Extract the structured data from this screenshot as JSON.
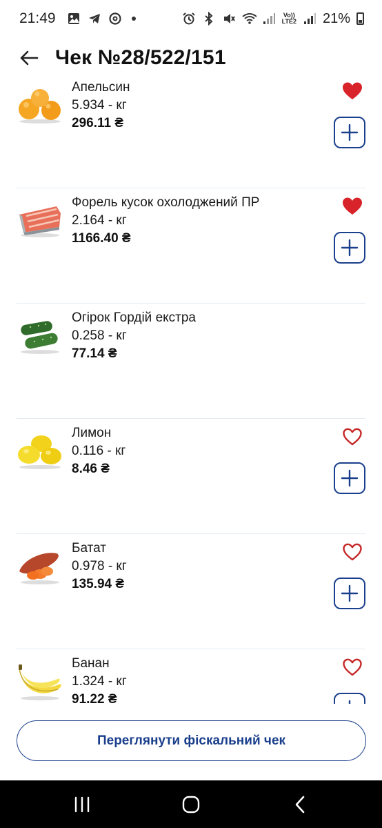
{
  "status_bar": {
    "time": "21:49",
    "network": "LTE2",
    "network_top": "Vo))",
    "battery": "21%",
    "left_icons": [
      "gallery-icon",
      "telegram-icon",
      "threads-icon",
      "dot-icon"
    ],
    "right_icons": [
      "alarm-icon",
      "bluetooth-icon",
      "mute-icon",
      "wifi-icon",
      "signal-icon",
      "signal-icon",
      "battery-icon"
    ]
  },
  "header": {
    "title": "Чек №28/522/151",
    "back_icon": "arrow-left-icon"
  },
  "currency": "₴",
  "items": [
    {
      "name": "Апельсин",
      "qty": "5.934 - кг",
      "price": "296.11 ₴",
      "favorite": true,
      "has_add": true,
      "image": "orange"
    },
    {
      "name": "Форель кусок охолоджений ПР",
      "qty": "2.164 - кг",
      "price": "1166.40 ₴",
      "favorite": true,
      "has_add": true,
      "image": "salmon"
    },
    {
      "name": "Огірок Гордій екстра",
      "qty": "0.258 - кг",
      "price": "77.14 ₴",
      "favorite": false,
      "has_add": false,
      "image": "cucumber"
    },
    {
      "name": "Лимон",
      "qty": "0.116 - кг",
      "price": "8.46 ₴",
      "favorite": false,
      "has_add": true,
      "image": "lemon"
    },
    {
      "name": "Батат",
      "qty": "0.978 - кг",
      "price": "135.94 ₴",
      "favorite": false,
      "has_add": true,
      "image": "sweet-potato"
    },
    {
      "name": "Банан",
      "qty": "1.324 - кг",
      "price": "91.22 ₴",
      "favorite": false,
      "has_add": true,
      "image": "banana"
    }
  ],
  "footer": {
    "button_label": "Переглянути фіскальний чек"
  },
  "colors": {
    "accent": "#1a3f8c",
    "heart": "#d8232a",
    "divider": "#e3ecf3"
  }
}
